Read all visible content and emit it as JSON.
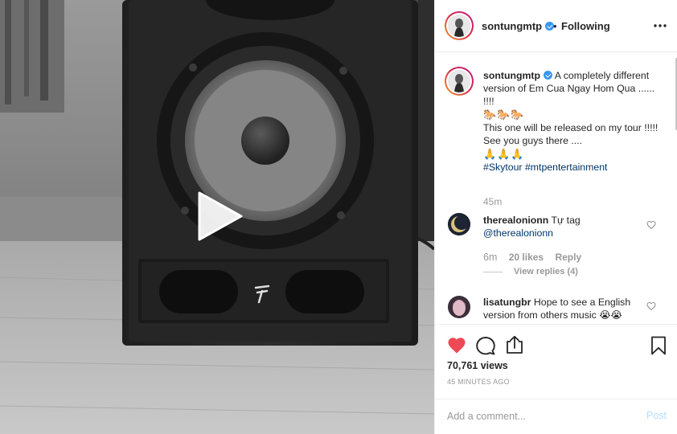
{
  "header": {
    "username": "sontungmtp",
    "separator": "•",
    "follow_status": "Following"
  },
  "caption": {
    "username": "sontungmtp",
    "line1": "A completely different version of Em Cua Ngay Hom Qua ...... !!!!",
    "emoji_line1": "🐎🐎🐎",
    "line2": "This one will be released on my tour !!!!!",
    "line3": "See you guys there ....",
    "emoji_line2": "🙏🙏🙏",
    "hashtags": "#Skytour #mtpentertainment",
    "time_ago": "45m"
  },
  "comments": [
    {
      "username": "therealonionn",
      "text": "Tự tag",
      "mention": "@therealonionn",
      "time_ago": "6m",
      "likes": "20 likes",
      "reply_label": "Reply",
      "view_replies": "View replies (4)"
    },
    {
      "username": "lisatungbr",
      "text": "Hope to see a English version from others music 😭😭"
    }
  ],
  "actions": {
    "views": "70,761 views",
    "posted": "45 MINUTES AGO"
  },
  "add_comment": {
    "placeholder": "Add a comment...",
    "post_label": "Post"
  },
  "colors": {
    "like_active": "#ed4956",
    "link": "#003569",
    "verified": "#3897f0",
    "post_disabled": "#b2dffc"
  },
  "icons": [
    "play-icon",
    "more-icon",
    "verified-icon",
    "heart-icon",
    "comment-icon",
    "share-icon",
    "bookmark-icon"
  ]
}
